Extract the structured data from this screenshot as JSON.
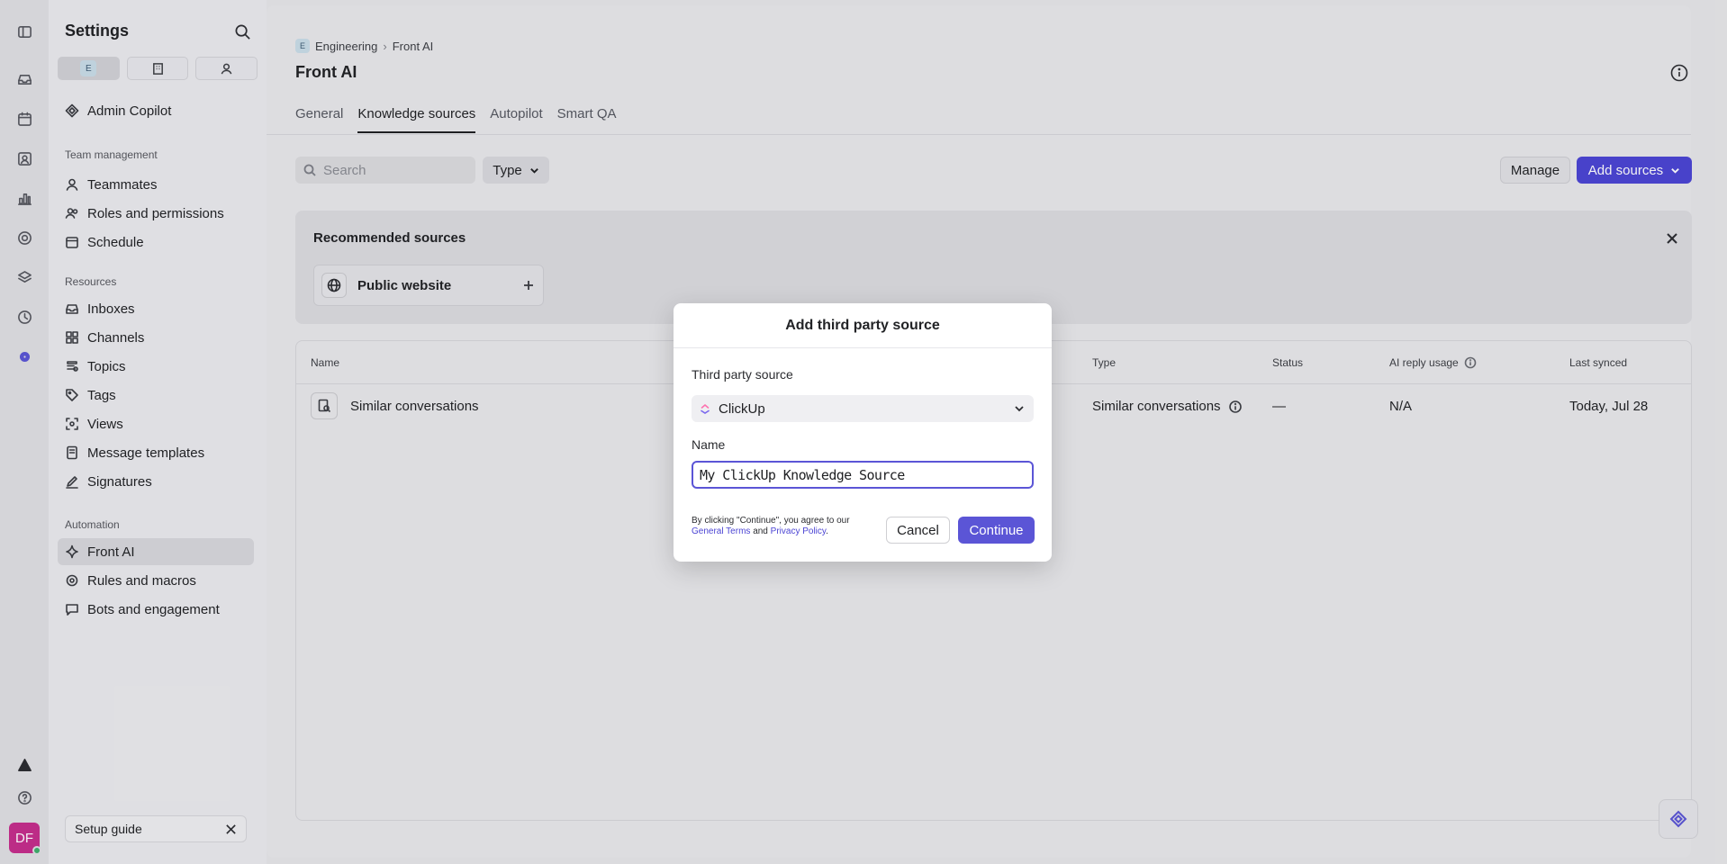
{
  "sidebar": {
    "title": "Settings",
    "workspace_initial": "E",
    "admin_copilot": "Admin Copilot",
    "sections": {
      "team": "Team management",
      "resources": "Resources",
      "automation": "Automation"
    },
    "team_items": [
      "Teammates",
      "Roles and permissions",
      "Schedule"
    ],
    "resource_items": [
      "Inboxes",
      "Channels",
      "Topics",
      "Tags",
      "Views",
      "Message templates",
      "Signatures"
    ],
    "automation_items": [
      "Front AI",
      "Rules and macros",
      "Bots and engagement"
    ],
    "setup_guide": "Setup guide"
  },
  "user": {
    "initials": "DF"
  },
  "breadcrumb": {
    "parent": "Engineering",
    "current": "Front AI"
  },
  "page": {
    "title": "Front AI"
  },
  "tabs": [
    "General",
    "Knowledge sources",
    "Autopilot",
    "Smart QA"
  ],
  "toolbar": {
    "search_placeholder": "Search",
    "type_filter": "Type",
    "manage": "Manage",
    "add_sources": "Add sources"
  },
  "recommended": {
    "title": "Recommended sources",
    "card": "Public website"
  },
  "table": {
    "columns": [
      "Name",
      "Type",
      "Status",
      "AI reply usage",
      "Last synced"
    ],
    "rows": [
      {
        "name": "Similar conversations",
        "type": "Similar conversations",
        "status": "—",
        "usage": "N/A",
        "last_synced": "Today, Jul 28"
      }
    ]
  },
  "modal": {
    "title": "Add third party source",
    "source_label": "Third party source",
    "source_value": "ClickUp",
    "name_label": "Name",
    "name_value": "My ClickUp Knowledge Source",
    "legal_prefix": "By clicking \"Continue\", you agree to our",
    "legal_terms": "General Terms",
    "legal_and": "and",
    "legal_privacy": "Privacy Policy",
    "legal_suffix": ".",
    "cancel": "Cancel",
    "continue": "Continue"
  },
  "colors": {
    "accent": "#5b55d6",
    "accent_dark": "#4b44d4",
    "avatar": "#c62d8c"
  }
}
